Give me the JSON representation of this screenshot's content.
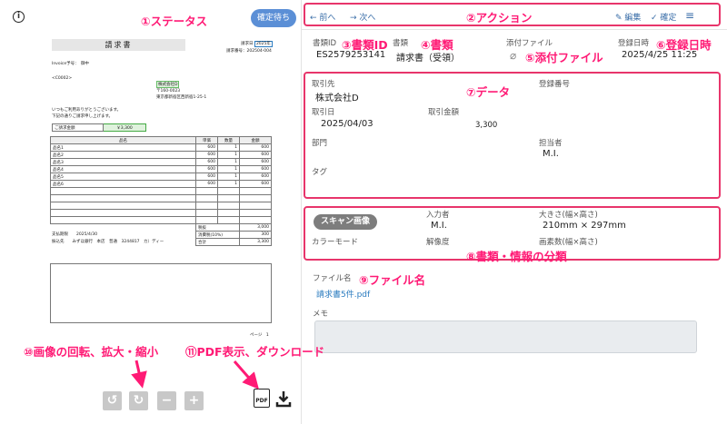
{
  "left_panel": {
    "info_icon": "i",
    "status_button": "確定待ち",
    "document": {
      "title": "請求書",
      "invoice_no_label": "請求日",
      "invoice_no_value": "2025年",
      "invoice_number_label": "請求番号：",
      "invoice_number_value": "202504-004",
      "invoice_tag_label": "Invoice予号：",
      "invoice_tag_value": "御中",
      "customer_code": "<C0002>",
      "company_stamp": "株式会社D",
      "postal": "〒160-0023",
      "address": "東京都新宿区西新宿1-25-1",
      "greeting1": "いつもご利用ありがとうございます。",
      "greeting2": "下記の通りご請求申し上げます。",
      "amount_label": "ご請求金額",
      "amount_value": "￥3,300",
      "col_name": "品名",
      "col_price": "単価",
      "col_qty": "数量",
      "col_amount": "金額",
      "rows": [
        {
          "name": "品名1",
          "price": "600",
          "qty": "1",
          "amount": "600"
        },
        {
          "name": "品名2",
          "price": "600",
          "qty": "1",
          "amount": "600"
        },
        {
          "name": "品名3",
          "price": "600",
          "qty": "1",
          "amount": "600"
        },
        {
          "name": "品名4",
          "price": "600",
          "qty": "1",
          "amount": "600"
        },
        {
          "name": "品名5",
          "price": "600",
          "qty": "1",
          "amount": "600"
        },
        {
          "name": "品名6",
          "price": "600",
          "qty": "1",
          "amount": "600"
        }
      ],
      "subtotal_label": "税抜",
      "subtotal_value": "3,000",
      "tax_label": "消費税(10%)",
      "tax_value": "300",
      "total_label": "合計",
      "total_value": "3,300",
      "due_label": "支払期限",
      "due_value": "2025/4/30",
      "bank_label": "振込先",
      "bank_value": "みずほ銀行　本店　普通　3244817　カ）ディー",
      "page_label": "ページ　1"
    },
    "controls": {
      "rotate_left": "↺",
      "rotate_right": "↻",
      "zoom_out": "−",
      "zoom_in": "+",
      "pdf_label": "PDF"
    }
  },
  "toolbar": {
    "prev": "← 前へ",
    "next": "→ 次へ",
    "edit": "編集",
    "confirm": "確定",
    "menu": "≡"
  },
  "header_fields": {
    "doc_id_label": "書類ID",
    "doc_id_value": "ES2579253141",
    "doc_type_label": "書類",
    "doc_type_value": "請求書（受領）",
    "attachment_label": "添付ファイル",
    "registered_label": "登録日時",
    "registered_value": "2025/4/25 11:25"
  },
  "data_section": {
    "partner_label": "取引先",
    "partner_value": "株式会社D",
    "reg_no_label": "登録番号",
    "date_label": "取引日",
    "date_value": "2025/04/03",
    "amount_label": "取引金額",
    "amount_value": "3,300",
    "dept_label": "部門",
    "person_label": "担当者",
    "person_value": "M.I.",
    "tag_label": "タグ"
  },
  "classification": {
    "chip": "スキャン画像",
    "inputter_label": "入力者",
    "inputter_value": "M.I.",
    "size_label": "大きさ(幅×高さ)",
    "size_value": "210mm × 297mm",
    "color_label": "カラーモード",
    "resolution_label": "解像度",
    "pixels_label": "画素数(幅×高さ)"
  },
  "file_section": {
    "file_label": "ファイル名",
    "file_value": "請求書5件.pdf",
    "memo_label": "メモ"
  },
  "annotations": {
    "a1": "①ステータス",
    "a2": "②アクション",
    "a3": "③書類ID",
    "a4": "④書類",
    "a5": "⑤添付ファイル",
    "a6": "⑥登録日時",
    "a7": "⑦データ",
    "a8": "⑧書類・情報の分類",
    "a9": "⑨ファイル名",
    "a10": "⑩画像の回転、拡大・縮小",
    "a11": "⑪PDF表示、ダウンロード"
  },
  "colors": {
    "annotation": "#ff1a75",
    "status_button": "#5b8fd6",
    "link": "#2a7bbf"
  }
}
